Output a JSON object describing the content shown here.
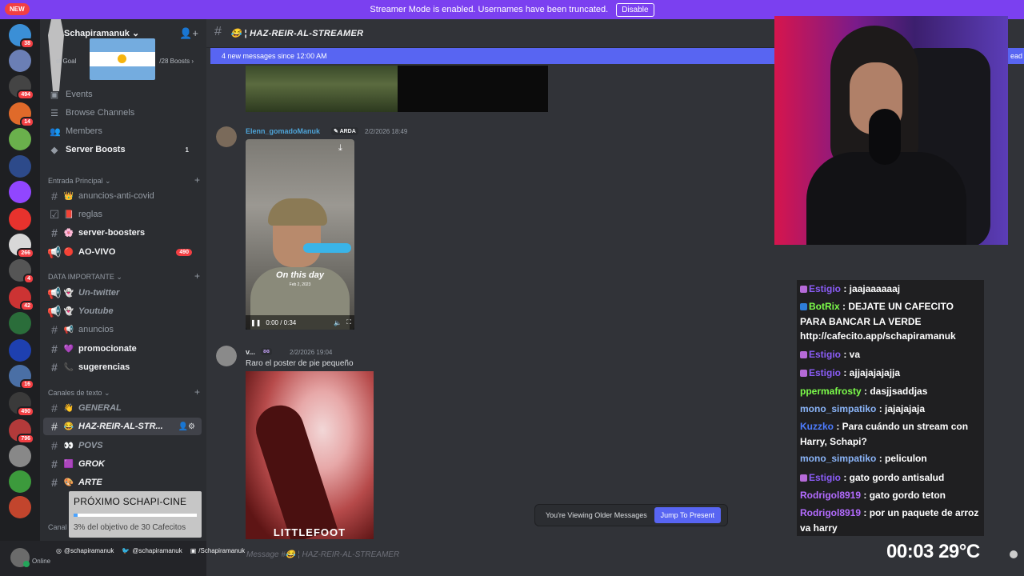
{
  "banner": {
    "text": "Streamer Mode is enabled. Usernames have been truncated.",
    "disable_label": "Disable",
    "new_tag": "NEW"
  },
  "guild": {
    "name": "Schapiramanuk",
    "goal_label": "st Goal",
    "boosts": "/28 Boosts"
  },
  "nav": [
    {
      "label": "Events",
      "icon": "calendar-icon"
    },
    {
      "label": "Browse Channels",
      "icon": "browse-icon"
    },
    {
      "label": "Members",
      "icon": "members-icon"
    },
    {
      "label": "Server Boosts",
      "icon": "boost-icon",
      "count": "1"
    }
  ],
  "categories": {
    "entrada": "Entrada Principal",
    "data": "DATA IMPORTANTE",
    "texto": "Canales de texto",
    "other": "Canal"
  },
  "channels": {
    "c1": {
      "name": "anuncios-anti-covid",
      "emoji": "👑"
    },
    "c2": {
      "name": "reglas",
      "emoji": "📕"
    },
    "c3": {
      "name": "server-boosters",
      "emoji": "🌸"
    },
    "c4": {
      "name": "AO-VIVO",
      "emoji": "🔴",
      "badge": "490"
    },
    "c5": {
      "name": "Un-twitter",
      "emoji": "👻"
    },
    "c6": {
      "name": "Youtube",
      "emoji": "👻"
    },
    "c7": {
      "name": "anuncios",
      "emoji": "📢"
    },
    "c8": {
      "name": "promocionate",
      "emoji": "💜"
    },
    "c9": {
      "name": "sugerencias",
      "emoji": "📞"
    },
    "c10": {
      "name": "GENERAL",
      "emoji": "👋"
    },
    "c11": {
      "name": "HAZ-REIR-AL-STR...",
      "emoji": "😂"
    },
    "c12": {
      "name": "POVS",
      "emoji": "👀"
    },
    "c13": {
      "name": "GROK",
      "emoji": "🟪"
    },
    "c14": {
      "name": "ARTE",
      "emoji": "🎨"
    }
  },
  "cine": {
    "title": "PRÓXIMO SCHAPI-CINE",
    "sub": "3% del objetivo de 30 Cafecitos",
    "progress": 0.03
  },
  "user_panel": {
    "status": "Online",
    "instagram": "@schapiramanuk",
    "twitter": "@schapiramanuk",
    "twitch": "/Schapiramanuk"
  },
  "chat": {
    "title": "😂 ¦ HAZ-REIR-AL-STREAMER",
    "new_messages": "4 new messages since 12:00 AM",
    "mark_read": "ead",
    "composer": "Message #😂 ¦ HAZ-REIR-AL-STREAMER",
    "older_text": "You're Viewing Older Messages",
    "jump_label": "Jump To Present"
  },
  "messages": [
    {
      "author": "Elenn_gomadoManuk",
      "tag": "ARDA",
      "time": "2/2/2026 18:49",
      "video_caption": "On this day",
      "video_date": "Feb 2, 2023",
      "video_time": "0:00 / 0:34"
    },
    {
      "author": "v...",
      "tag": "ʚɞ",
      "time": "2/2/2026 19:04",
      "text": "Raro el poster de pie pequeño",
      "poster_title": "LITTLEFOOT"
    }
  ],
  "twitch_chat": [
    {
      "user": "Estigio",
      "color": "#8a5cf6",
      "text": "jaajaaaaaaj"
    },
    {
      "user": "BotRix",
      "color": "#7cfc4a",
      "text": "DEJATE UN CAFECITO PARA BANCAR LA VERDE http://cafecito.app/schapiramanuk"
    },
    {
      "user": "Estigio",
      "color": "#8a5cf6",
      "text": "va"
    },
    {
      "user": "Estigio",
      "color": "#8a5cf6",
      "text": "ajjajajajajja"
    },
    {
      "user": "ppermafrosty",
      "color": "#7cfc4a",
      "text": "dasjjsaddjas"
    },
    {
      "user": "mono_simpatiko",
      "color": "#8ab4f8",
      "text": "jajajajaja"
    },
    {
      "user": "Kuzzko",
      "color": "#4d7cff",
      "text": "Para cuándo un stream con Harry, Schapi?"
    },
    {
      "user": "mono_simpatiko",
      "color": "#8ab4f8",
      "text": "peliculon"
    },
    {
      "user": "Estigio",
      "color": "#8a5cf6",
      "text": "gato gordo antisalud"
    },
    {
      "user": "Rodrigol8919",
      "color": "#b36bff",
      "text": "gato gordo teton"
    },
    {
      "user": "Rodrigol8919",
      "color": "#b36bff",
      "text": "por un paquete de arroz va harry"
    }
  ],
  "overlay": {
    "clock": "00:03",
    "temp": "29°C"
  },
  "server_badges": [
    "38",
    "494",
    "14",
    "266",
    "4",
    "42",
    "16",
    "490",
    "796"
  ]
}
